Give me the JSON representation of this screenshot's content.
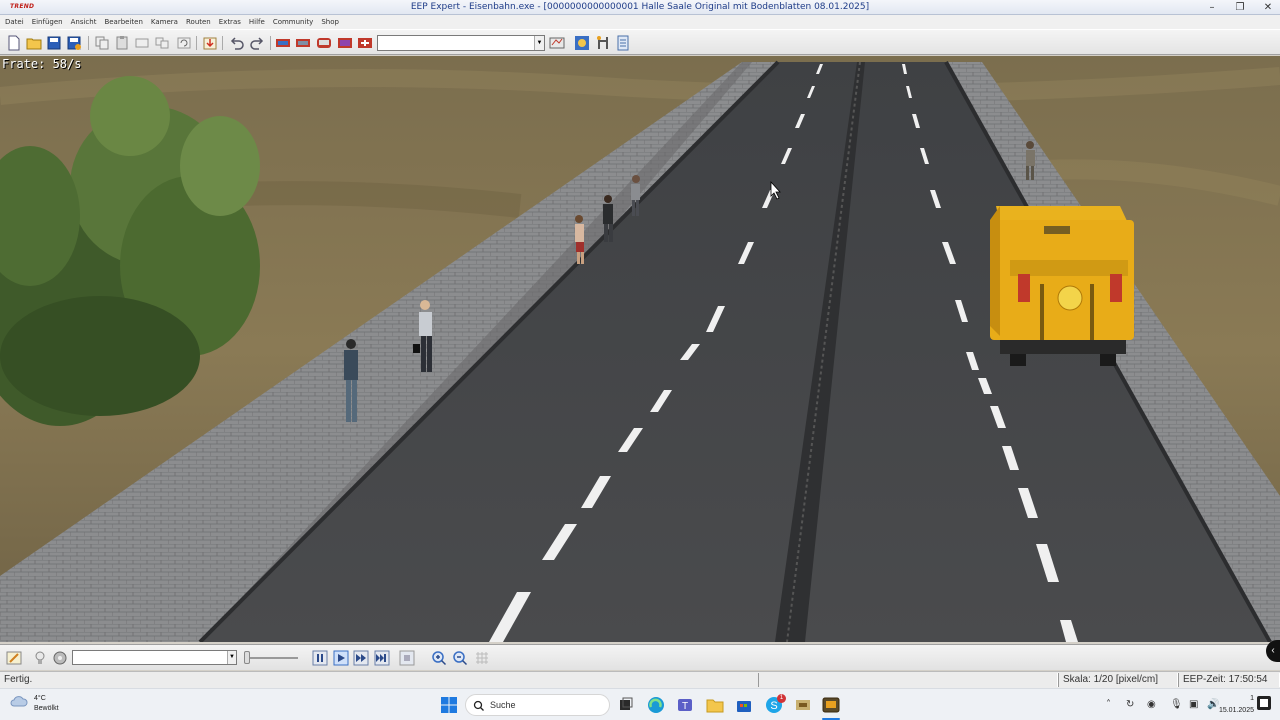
{
  "window": {
    "logo": "TREND",
    "title": "EEP Expert - Eisenbahn.exe - [0000000000000001 Halle Saale Original mit Bodenblatten 08.01.2025]",
    "controls": [
      "minimize",
      "maximize",
      "close"
    ]
  },
  "menu": [
    "Datei",
    "Einfügen",
    "Ansicht",
    "Bearbeiten",
    "Kamera",
    "Routen",
    "Extras",
    "Hilfe",
    "Community",
    "Shop"
  ],
  "toolbar": {
    "buttons": [
      "new-file",
      "open-file",
      "save",
      "save-as",
      "copy",
      "paste",
      "cut",
      "duplicate",
      "rotate",
      "import",
      "undo",
      "redo",
      "track-edit-1",
      "track-edit-2",
      "track-edit-3",
      "track-edit-4",
      "track-edit-5",
      "route-settings",
      "layer",
      "tools",
      "properties"
    ],
    "combo_value": ""
  },
  "viewport": {
    "fps_label": "Frate: 58/s"
  },
  "controls": {
    "combo_value": "",
    "buttons": [
      "pen-icon",
      "bulb-icon",
      "gear-icon",
      "pause",
      "play",
      "fast-forward",
      "fastest-forward",
      "stop",
      "zoom-in",
      "zoom-out",
      "grid"
    ]
  },
  "status": {
    "ready": "Fertig.",
    "scale": "Skala: 1/20 [pixel/cm]",
    "time": "EEP-Zeit: 17:50:54"
  },
  "taskbar": {
    "temperature": "4°C",
    "weather": "Bewölkt",
    "search_label": "Suche",
    "clock_time": "1",
    "clock_date": "15.01.2025",
    "badge_count": "1"
  }
}
